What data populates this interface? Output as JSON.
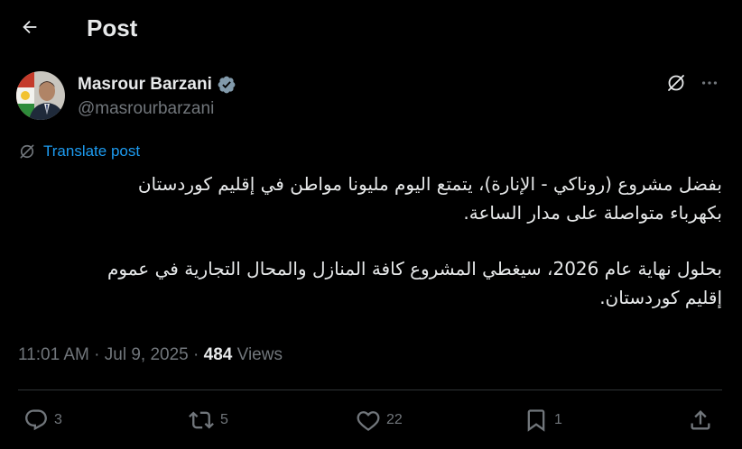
{
  "header": {
    "title": "Post",
    "back_icon": "arrow-left-icon"
  },
  "author": {
    "name": "Masrour Barzani",
    "handle": "@masrourbarzani",
    "verified": true,
    "verified_color": "#71767b"
  },
  "actions_top": {
    "grok_icon": "grok-icon",
    "more_icon": "more-horizontal-icon"
  },
  "translate": {
    "label": "Translate post",
    "color": "#1d9bf0"
  },
  "post": {
    "paragraph1_line1": "بفضل مشروع (روناكي - الإنارة)، يتمتع اليوم مليونا مواطن في إقليم كوردستان",
    "paragraph1_line2": "بكهرباء متواصلة على مدار الساعة.",
    "paragraph2_line1": "بحلول نهاية عام 2026، سيغطي المشروع كافة المنازل والمحال التجارية في عموم",
    "paragraph2_line2": "إقليم كوردستان."
  },
  "meta": {
    "time": "11:01 AM",
    "date": "Jul 9, 2025",
    "separator": "·",
    "views_count": "484",
    "views_label": "Views"
  },
  "engagement": {
    "replies": "3",
    "reposts": "5",
    "likes": "22",
    "bookmarks": "1"
  },
  "colors": {
    "background": "#000000",
    "text": "#e7e9ea",
    "muted": "#71767b",
    "accent": "#1d9bf0",
    "divider": "#2f3336"
  }
}
